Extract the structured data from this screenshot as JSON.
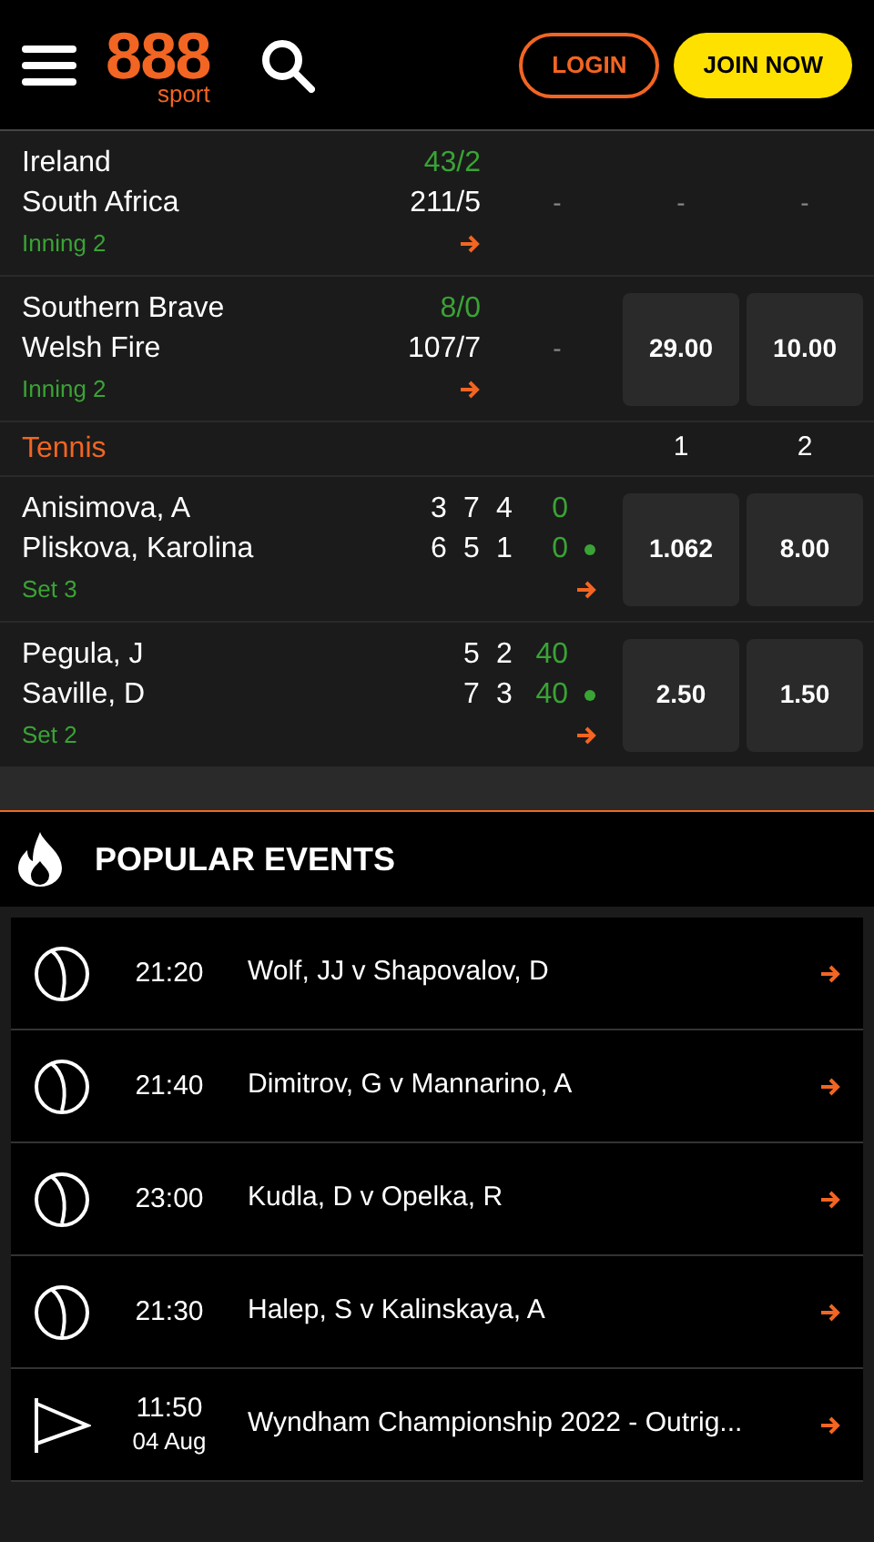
{
  "header": {
    "logo": "888",
    "logo_sub": "sport",
    "login": "LOGIN",
    "join": "JOIN NOW"
  },
  "cricket_events": [
    {
      "teams": [
        {
          "name": "Ireland",
          "score": "43/2",
          "batting": true
        },
        {
          "name": "South Africa",
          "score": "211/5",
          "batting": false
        }
      ],
      "status": "Inning 2",
      "odds": [
        {
          "kind": "empty",
          "text": "-"
        },
        {
          "kind": "empty",
          "text": "-"
        },
        {
          "kind": "empty",
          "text": "-"
        }
      ]
    },
    {
      "teams": [
        {
          "name": "Southern Brave",
          "score": "8/0",
          "batting": true
        },
        {
          "name": "Welsh Fire",
          "score": "107/7",
          "batting": false
        }
      ],
      "status": "Inning 2",
      "odds": [
        {
          "kind": "empty",
          "text": "-"
        },
        {
          "kind": "price",
          "text": "29.00"
        },
        {
          "kind": "price",
          "text": "10.00"
        }
      ]
    }
  ],
  "tennis": {
    "title": "Tennis",
    "columns": [
      "1",
      "2"
    ],
    "events": [
      {
        "players": [
          {
            "name": "Anisimova, A",
            "sets": [
              "3",
              "7",
              "4"
            ],
            "points": "0",
            "serving": false
          },
          {
            "name": "Pliskova, Karolina",
            "sets": [
              "6",
              "5",
              "1"
            ],
            "points": "0",
            "serving": true
          }
        ],
        "status": "Set 3",
        "odds": [
          "1.062",
          "8.00"
        ]
      },
      {
        "players": [
          {
            "name": "Pegula, J",
            "sets": [
              "5",
              "2"
            ],
            "points": "40",
            "serving": false
          },
          {
            "name": "Saville, D",
            "sets": [
              "7",
              "3"
            ],
            "points": "40",
            "serving": true
          }
        ],
        "status": "Set 2",
        "odds": [
          "2.50",
          "1.50"
        ]
      }
    ]
  },
  "popular": {
    "title": "POPULAR EVENTS",
    "events": [
      {
        "kind": "tennis",
        "time": "21:20",
        "name": "Wolf, JJ v Shapovalov, D"
      },
      {
        "kind": "tennis",
        "time": "21:40",
        "name": "Dimitrov, G v Mannarino, A"
      },
      {
        "kind": "tennis",
        "time": "23:00",
        "name": "Kudla, D v Opelka, R"
      },
      {
        "kind": "tennis",
        "time": "21:30",
        "name": "Halep, S v Kalinskaya, A"
      },
      {
        "kind": "golf",
        "time": "11:50",
        "date": "04 Aug",
        "name": "Wyndham Championship 2022 - Outrig..."
      }
    ]
  }
}
